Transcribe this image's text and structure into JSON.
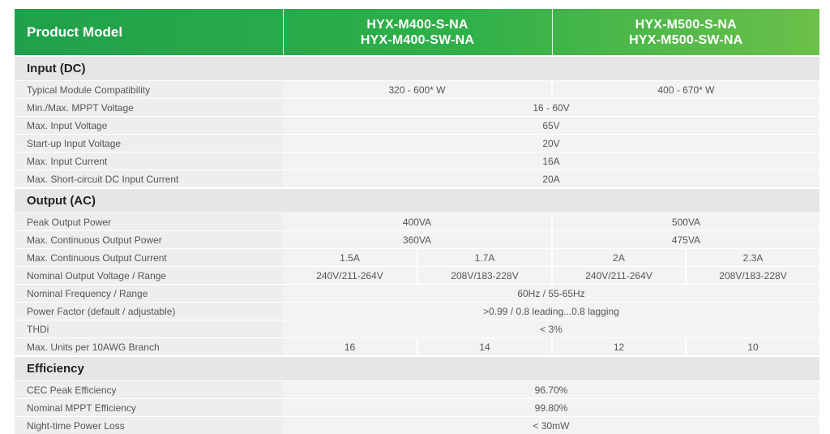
{
  "header": {
    "label": "Product Model",
    "models": [
      {
        "line1": "HYX-M400-S-NA",
        "line2": "HYX-M400-SW-NA"
      },
      {
        "line1": "HYX-M500-S-NA",
        "line2": "HYX-M500-SW-NA"
      }
    ]
  },
  "input": {
    "title": "Input (DC)",
    "rows": [
      {
        "label": "Typical Module Compatibility",
        "m400": "320 - 600* W",
        "m500": "400 - 670* W"
      },
      {
        "label": "Min./Max. MPPT Voltage",
        "all": "16 - 60V"
      },
      {
        "label": "Max. Input Voltage",
        "all": "65V"
      },
      {
        "label": "Start-up Input Voltage",
        "all": "20V"
      },
      {
        "label": "Max. Input Current",
        "all": "16A"
      },
      {
        "label": "Max. Short-circuit DC Input Current",
        "all": "20A"
      }
    ]
  },
  "output": {
    "title": "Output (AC)",
    "peak": {
      "label": "Peak Output Power",
      "m400": "400VA",
      "m500": "500VA"
    },
    "cont_power": {
      "label": "Max. Continuous Output Power",
      "m400": "360VA",
      "m500": "475VA"
    },
    "cont_current": {
      "label": "Max. Continuous Output Current",
      "values": [
        "1.5A",
        "1.7A",
        "2A",
        "2.3A"
      ]
    },
    "voltage": {
      "label": "Nominal Output Voltage / Range",
      "values": [
        "240V/211-264V",
        "208V/183-228V",
        "240V/211-264V",
        "208V/183-228V"
      ]
    },
    "frequency": {
      "label": "Nominal Frequency / Range",
      "all": "60Hz / 55-65Hz"
    },
    "power_factor": {
      "label": "Power Factor (default / adjustable)",
      "all": ">0.99 / 0.8 leading...0.8 lagging"
    },
    "thdi": {
      "label": "THDi",
      "all": "< 3%"
    },
    "units": {
      "label": "Max. Units per 10AWG Branch",
      "values": [
        "16",
        "14",
        "12",
        "10"
      ]
    }
  },
  "efficiency": {
    "title": "Efficiency",
    "rows": [
      {
        "label": "CEC Peak Efficiency",
        "all": "96.70%"
      },
      {
        "label": "Nominal MPPT Efficiency",
        "all": "99.80%"
      },
      {
        "label": "Night-time Power Loss",
        "all": "< 30mW"
      }
    ]
  }
}
